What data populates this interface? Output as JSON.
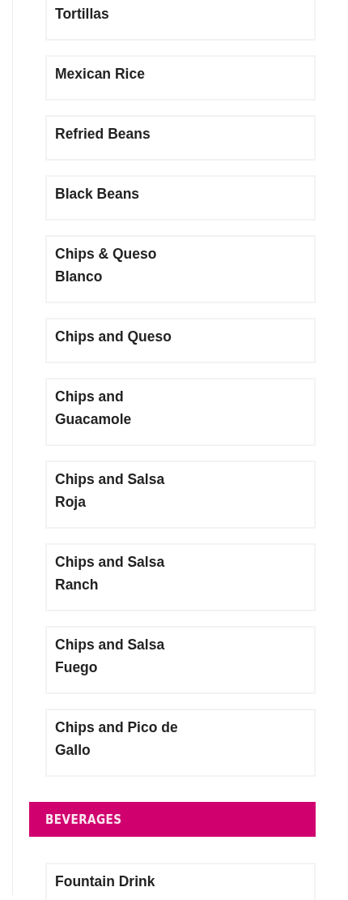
{
  "sections": [
    {
      "items": [
        {
          "name": "Tortillas"
        },
        {
          "name": "Mexican Rice"
        },
        {
          "name": "Refried Beans"
        },
        {
          "name": "Black Beans"
        },
        {
          "name": "Chips & Queso\nBlanco"
        },
        {
          "name": "Chips and Queso"
        },
        {
          "name": "Chips and\nGuacamole"
        },
        {
          "name": "Chips and Salsa\nRoja"
        },
        {
          "name": "Chips and Salsa\nRanch"
        },
        {
          "name": "Chips and Salsa\nFuego"
        },
        {
          "name": "Chips and Pico de\nGallo"
        }
      ]
    },
    {
      "title": "BEVERAGES",
      "items": [
        {
          "name": "Fountain Drink"
        }
      ]
    }
  ]
}
